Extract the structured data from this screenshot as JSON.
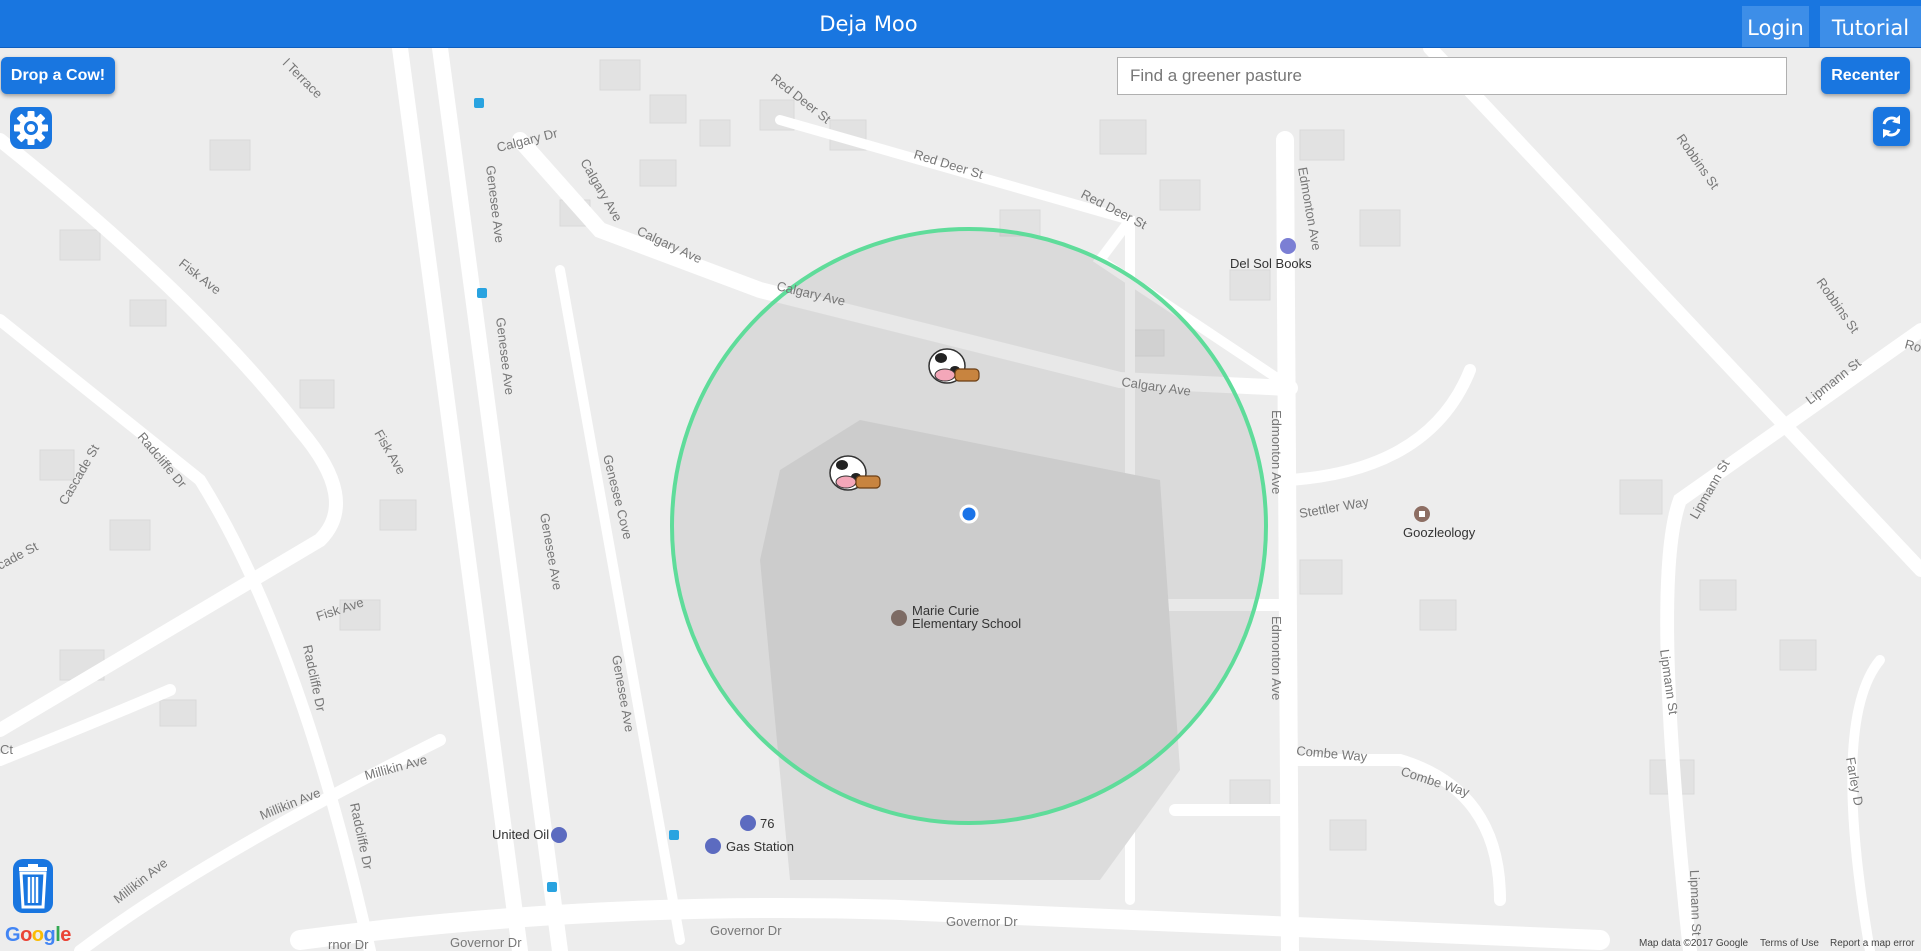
{
  "app": {
    "title": "Deja Moo",
    "nav": {
      "login": "Login",
      "tutorial": "Tutorial"
    }
  },
  "controls": {
    "drop_cow": "Drop a Cow!",
    "recenter": "Recenter",
    "search_placeholder": "Find a greener pasture",
    "settings_icon": "gear-icon",
    "refresh_icon": "refresh-icon",
    "trash_icon": "trash-icon"
  },
  "map": {
    "streets": [
      "Red Deer St",
      "Red Deer St",
      "Red Deer St",
      "Calgary Dr",
      "Calgary Ave",
      "Calgary Ave",
      "Calgary Ave",
      "Calgary Ave",
      "Edmonton Ave",
      "Edmonton Ave",
      "Edmonton Ave",
      "Robbins St",
      "Robbins St",
      "Lipmann St",
      "Lipmann St",
      "Lipmann St",
      "Lipmann St",
      "Stettler Way",
      "Combe Way",
      "Combe Way",
      "Genesee Ave",
      "Genesee Ave",
      "Genesee Ave",
      "Genesee Ave",
      "Genesee Cove",
      "Fisk Ave",
      "Fisk Ave",
      "Fisk Ave",
      "Radcliffe Dr",
      "Radcliffe Dr",
      "Radcliffe Dr",
      "Cascade St",
      "cade St",
      "Millikin Ave",
      "Millikin Ave",
      "Millikin Ave",
      "Governor Dr",
      "Governor Dr",
      "Governor Dr",
      "rnor Dr",
      "l Terrace",
      "Farley D",
      "Ro",
      "Ct"
    ],
    "places": {
      "del_sol": "Del Sol Books",
      "goozleology": "Goozleology",
      "school_line1": "Marie Curie",
      "school_line2": "Elementary School",
      "united_oil": "United Oil",
      "station_76": "76",
      "gas_station": "Gas Station"
    },
    "cow_count": 2,
    "colors": {
      "radius_stroke": "#5fdc9a",
      "location_dot": "#1a73e8",
      "header": "#1976e0"
    }
  },
  "attribution": {
    "map_data": "Map data ©2017 Google",
    "terms": "Terms of Use",
    "report": "Report a map error",
    "logo": "Google"
  }
}
